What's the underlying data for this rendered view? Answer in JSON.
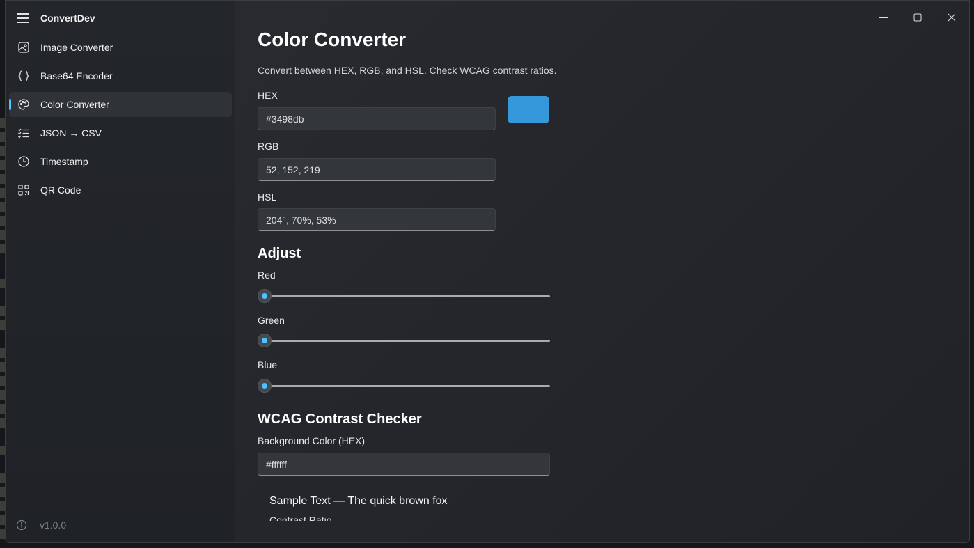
{
  "app": {
    "title": "ConvertDev",
    "version": "v1.0.0"
  },
  "sidebar": {
    "items": [
      {
        "label": "Image Converter",
        "icon": "image-icon"
      },
      {
        "label": "Base64 Encoder",
        "icon": "braces-icon"
      },
      {
        "label": "Color Converter",
        "icon": "palette-icon",
        "selected": true
      },
      {
        "label": "JSON ↔ CSV",
        "icon": "list-icon"
      },
      {
        "label": "Timestamp",
        "icon": "clock-icon"
      },
      {
        "label": "QR Code",
        "icon": "qr-code-icon"
      }
    ]
  },
  "page": {
    "title": "Color Converter",
    "subtitle": "Convert between HEX, RGB, and HSL. Check WCAG contrast ratios.",
    "hex": {
      "label": "HEX",
      "value": "#3498db"
    },
    "rgb": {
      "label": "RGB",
      "value": "52, 152, 219"
    },
    "hsl": {
      "label": "HSL",
      "value": "204°, 70%, 53%"
    },
    "swatch_color": "#3498db",
    "adjust": {
      "title": "Adjust",
      "red": {
        "label": "Red",
        "value": 0
      },
      "green": {
        "label": "Green",
        "value": 0
      },
      "blue": {
        "label": "Blue",
        "value": 0
      }
    },
    "wcag": {
      "title": "WCAG Contrast Checker",
      "bg_label": "Background Color (HEX)",
      "bg_value": "#ffffff",
      "sample_text": "Sample Text — The quick brown fox",
      "contrast_label": "Contrast Ratio"
    }
  },
  "colors": {
    "accent": "#4cc2ff"
  }
}
